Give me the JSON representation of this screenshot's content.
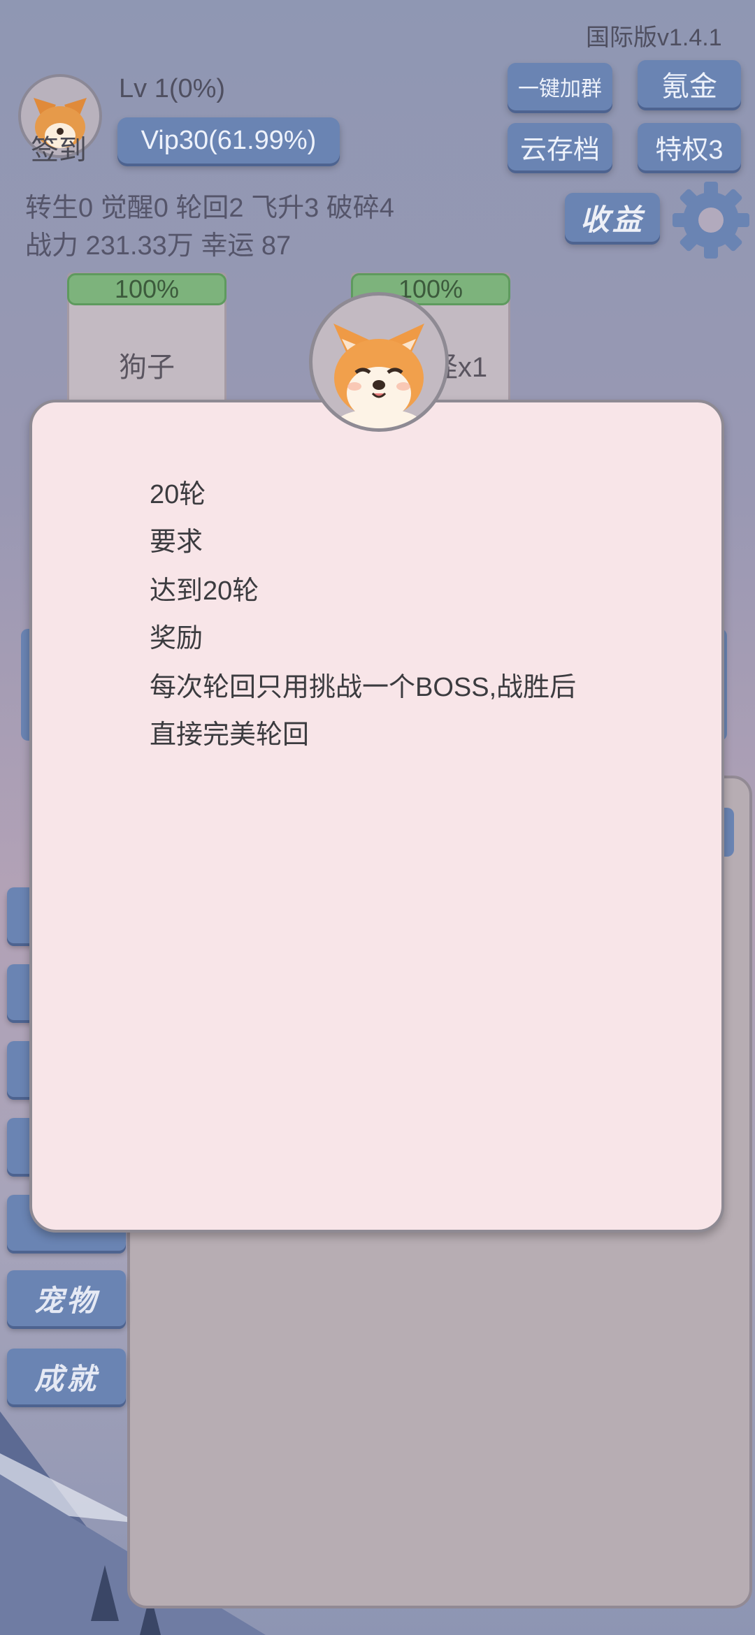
{
  "header": {
    "version": "国际版v1.4.1",
    "level": "Lv 1(0%)",
    "vip": "Vip30(61.99%)",
    "signin_label": "签到"
  },
  "top_buttons": {
    "join_group": "一键加群",
    "krypton": "氪金",
    "cloud_save": "云存档",
    "privilege": "特权3",
    "earnings": "收益"
  },
  "stats": {
    "line1": "转生0 觉醒0 轮回2 飞升3 破碎4",
    "line2": "战力 231.33万  幸运 87"
  },
  "cards": [
    {
      "percent": "100%",
      "name": "狗子"
    },
    {
      "percent": "100%",
      "name": "怪x1"
    }
  ],
  "side_tabs": {
    "pet": "宠物",
    "achievement": "成就"
  },
  "modal": {
    "lines": [
      "20轮",
      "要求",
      "达到20轮",
      "奖励",
      "每次轮回只用挑战一个BOSS,战胜后",
      "直接完美轮回"
    ]
  },
  "colors": {
    "button": "#6a84b3",
    "progress_green": "#7db37c",
    "modal_bg": "#f8e5e8"
  },
  "icons": [
    "corgi-avatar-icon",
    "gear-icon",
    "corgi-badge-icon"
  ]
}
